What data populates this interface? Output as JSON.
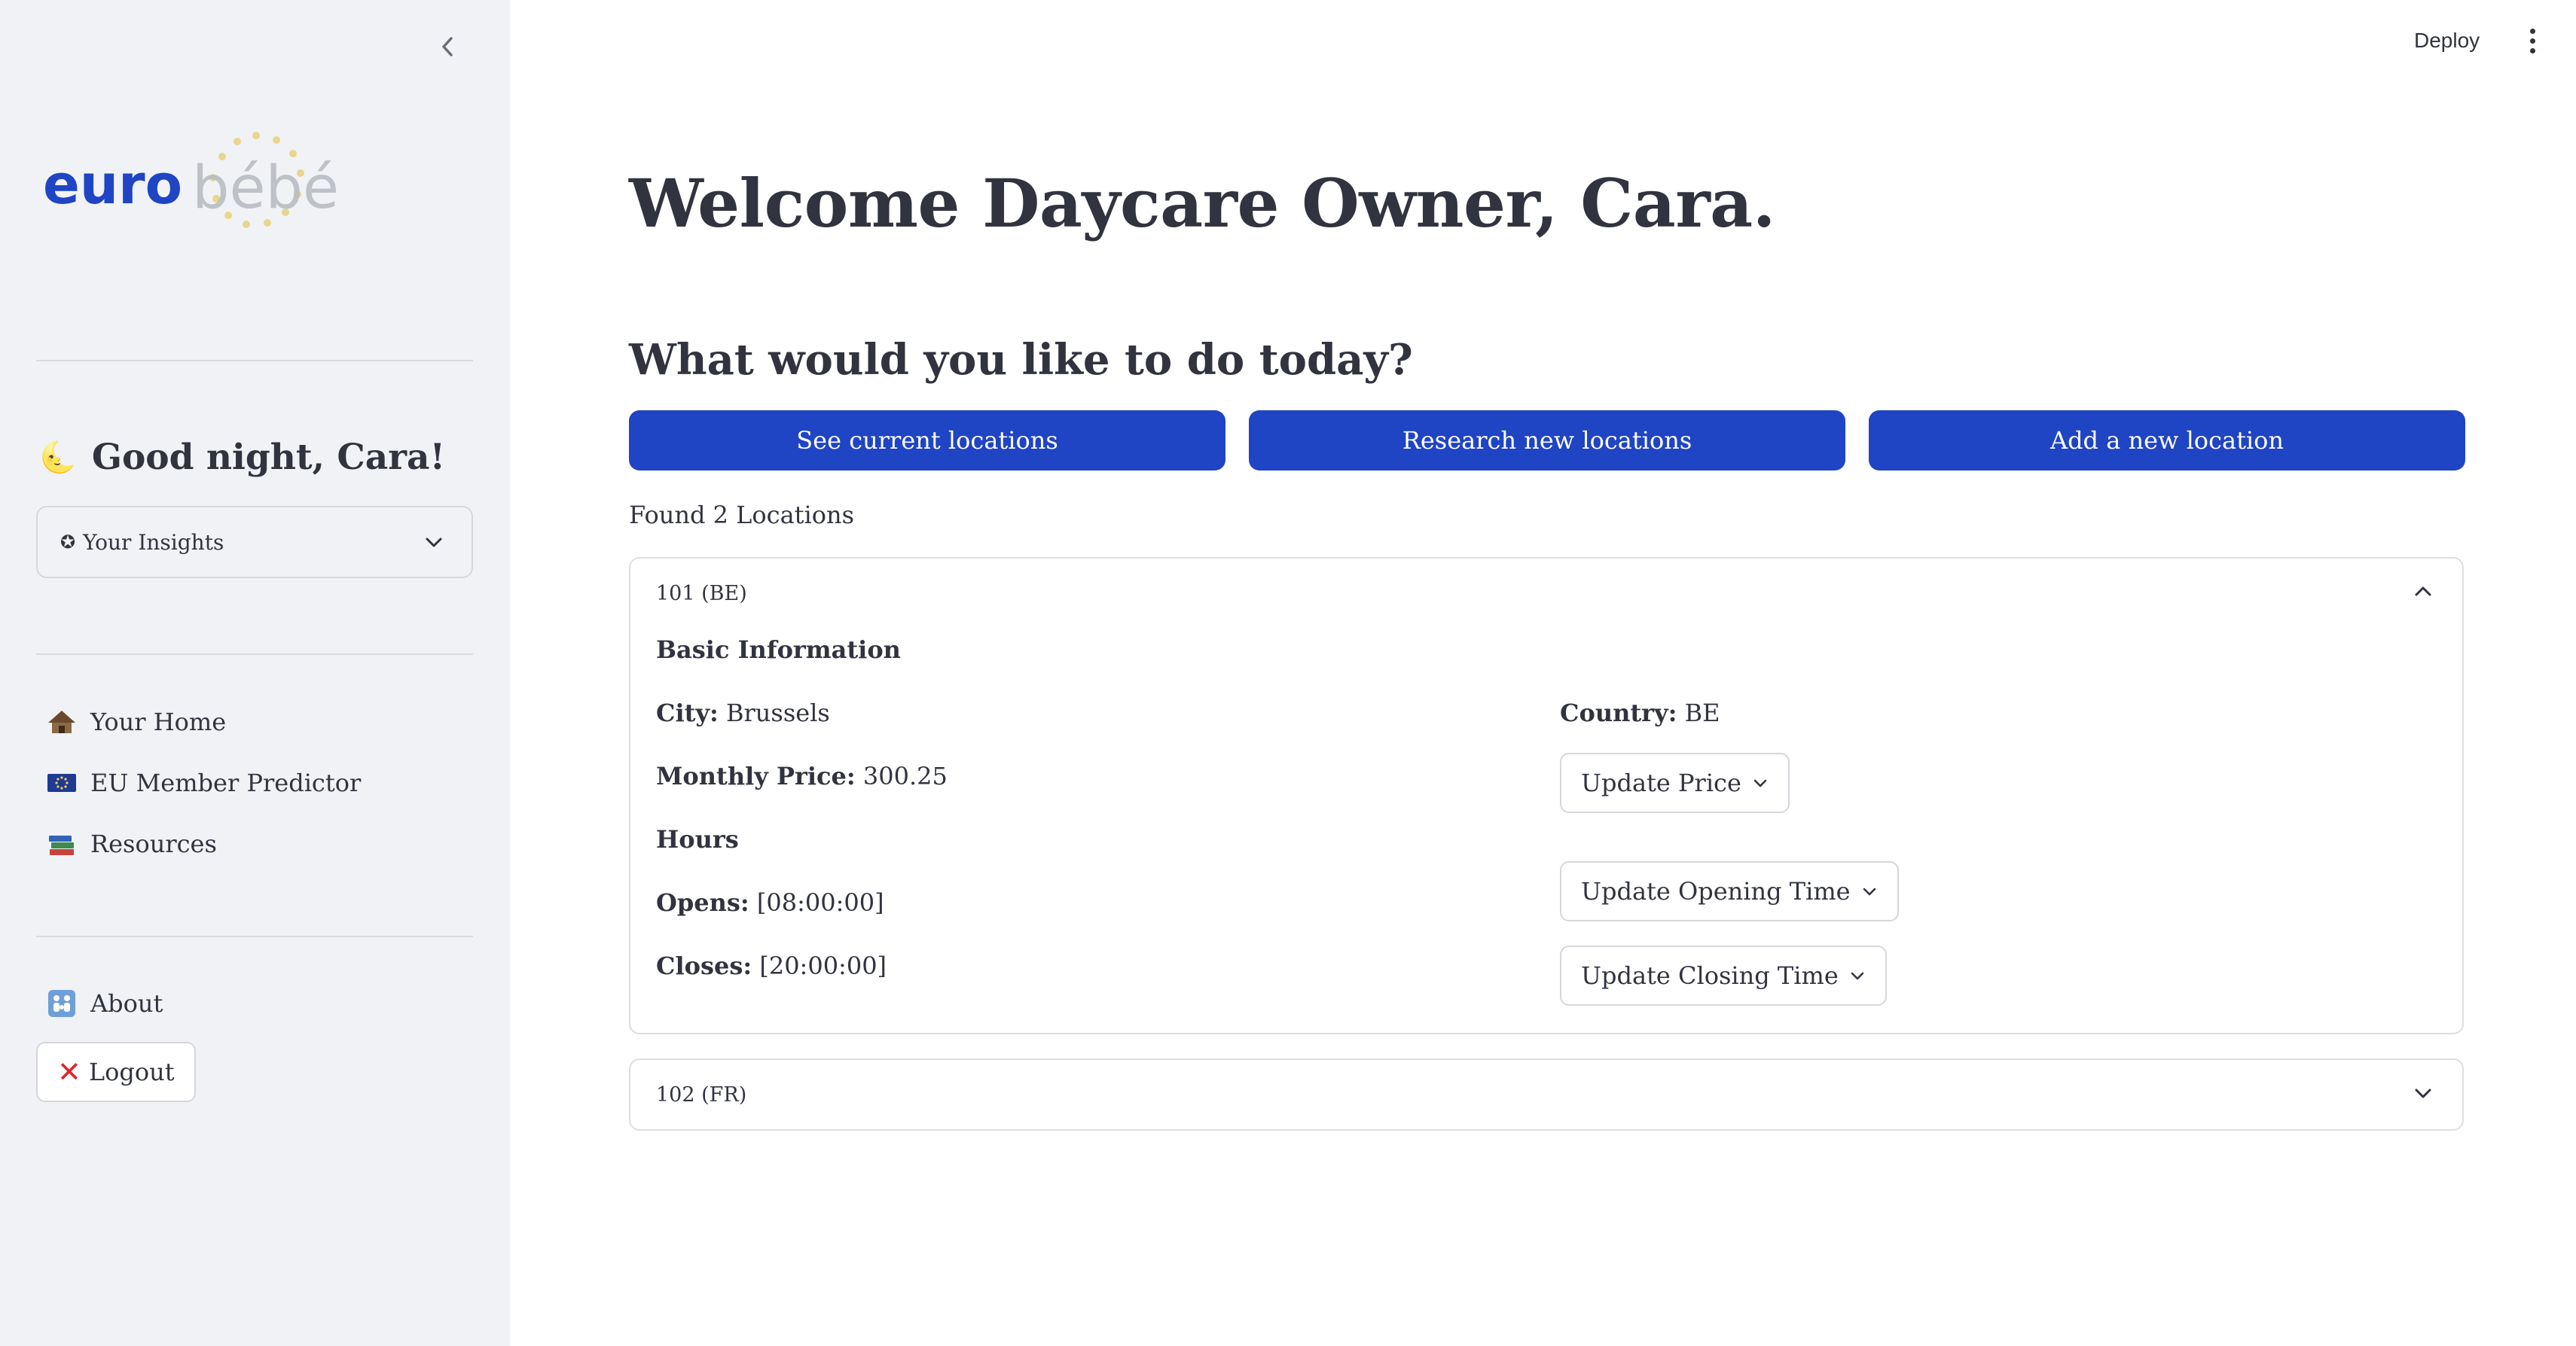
{
  "sidebar": {
    "logo": {
      "text_primary": "euro",
      "text_secondary": "bébé",
      "primary_color": "#1f44c4"
    },
    "greeting": {
      "emoji": "🌜",
      "text": "Good night, Cara!"
    },
    "insights_select": {
      "icon": "✪",
      "value": "Your Insights"
    },
    "nav": [
      {
        "icon": "hut-icon",
        "label": "Your Home"
      },
      {
        "icon": "eu-flag-icon",
        "label": "EU Member Predictor"
      },
      {
        "icon": "books-icon",
        "label": "Resources"
      },
      {
        "icon": "family-icon",
        "label": "About"
      }
    ],
    "logout": {
      "icon": "✕",
      "label": "Logout"
    }
  },
  "header": {
    "deploy_label": "Deploy"
  },
  "main": {
    "title": "Welcome Daycare Owner, Cara.",
    "subtitle": "What would you like to do today?",
    "actions": [
      "See current locations",
      "Research new locations",
      "Add a new location"
    ],
    "found_text": "Found 2 Locations",
    "locations": [
      {
        "header": "101 (BE)",
        "expanded": true,
        "basic_info_heading": "Basic Information",
        "city_label": "City:",
        "city": "Brussels",
        "country_label": "Country:",
        "country": "BE",
        "price_label": "Monthly Price:",
        "price": "300.25",
        "hours_heading": "Hours",
        "opens_label": "Opens:",
        "opens": "[08:00:00]",
        "closes_label": "Closes:",
        "closes": "[20:00:00]",
        "update_price": "Update Price",
        "update_opening": "Update Opening Time",
        "update_closing": "Update Closing Time"
      },
      {
        "header": "102 (FR)",
        "expanded": false
      }
    ]
  },
  "colors": {
    "primary": "#1f44c4",
    "sidebar_bg": "#f0f2f6",
    "text": "#31333f",
    "logout_x": "#e0262b"
  }
}
